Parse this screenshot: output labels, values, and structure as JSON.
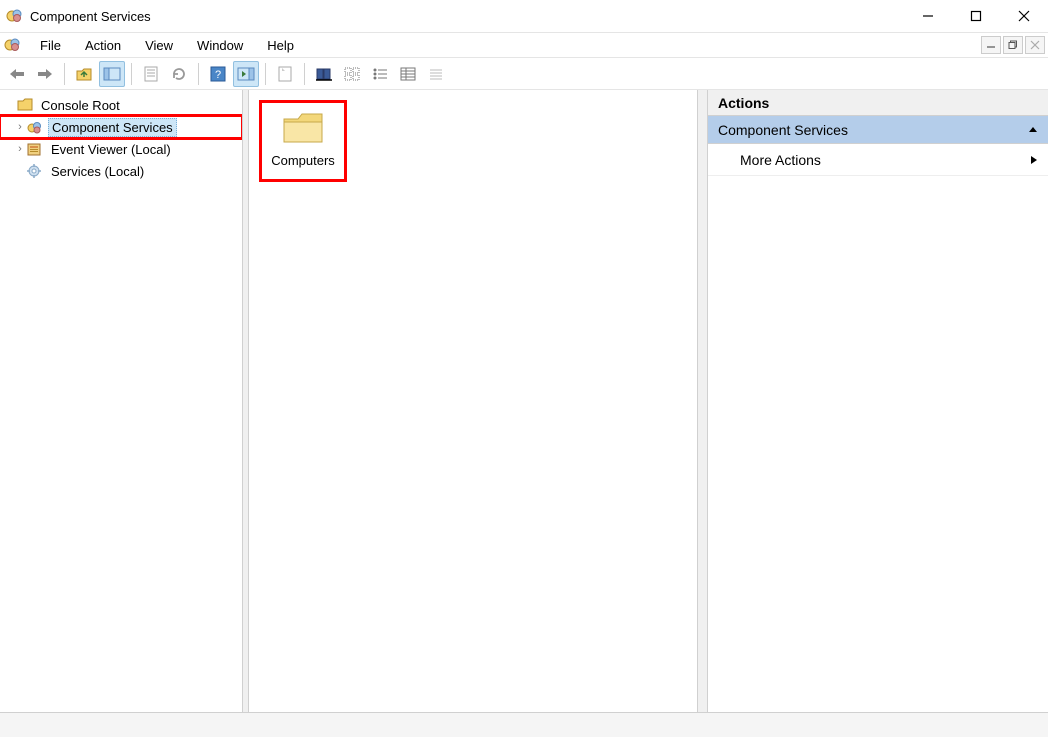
{
  "window": {
    "title": "Component Services"
  },
  "menu": {
    "items": [
      "File",
      "Action",
      "View",
      "Window",
      "Help"
    ]
  },
  "tree": {
    "root": "Console Root",
    "children": [
      {
        "label": "Component Services",
        "selected": true,
        "highlighted": true,
        "icon": "component-services-icon"
      },
      {
        "label": "Event Viewer (Local)",
        "icon": "event-viewer-icon"
      },
      {
        "label": "Services (Local)",
        "icon": "services-gear-icon"
      }
    ]
  },
  "content": {
    "items": [
      {
        "label": "Computers",
        "highlighted": true
      }
    ]
  },
  "actions": {
    "title": "Actions",
    "section": "Component Services",
    "rows": [
      "More Actions"
    ]
  }
}
